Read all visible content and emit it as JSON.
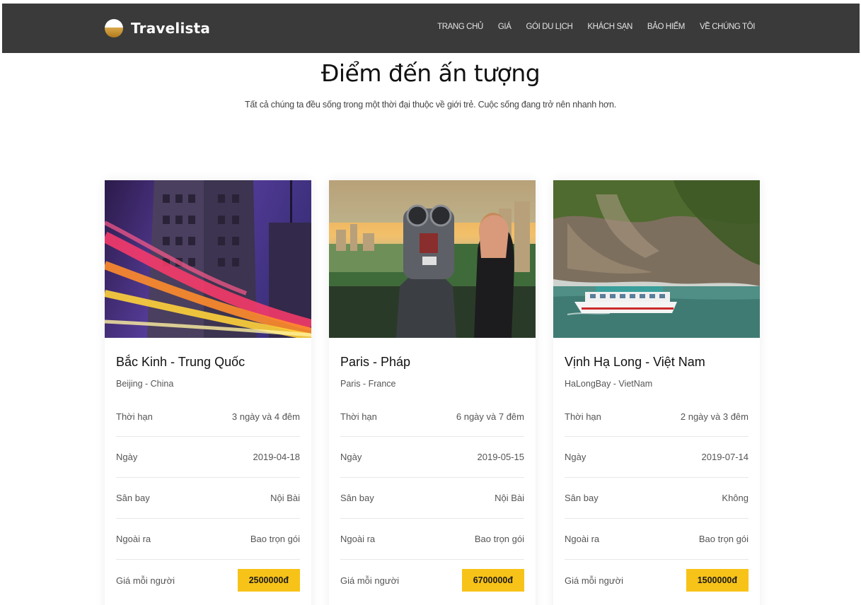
{
  "brand": {
    "name": "Travelista"
  },
  "nav": {
    "items": [
      "TRANG CHỦ",
      "GIÁ",
      "GÓI DU LỊCH",
      "KHÁCH SẠN",
      "BẢO HIỂM",
      "VỀ CHÚNG TÔI"
    ]
  },
  "hero": {
    "title": "Điểm đến ấn tượng",
    "subtitle": "Tất cả chúng ta đều sống trong một thời đại thuộc về giới trẻ. Cuộc sống đang trở nên nhanh hơn."
  },
  "cards": [
    {
      "title": "Bắc Kinh - Trung Quốc",
      "subtitle": "Beijing - China",
      "rows": [
        {
          "label": "Thời hạn",
          "value": "3 ngày và 4 đêm"
        },
        {
          "label": "Ngày",
          "value": "2019-04-18"
        },
        {
          "label": "Sân bay",
          "value": "Nội Bài"
        },
        {
          "label": "Ngoài ra",
          "value": "Bao trọn gói"
        }
      ],
      "price_label": "Giá mỗi người",
      "price": "2500000đ"
    },
    {
      "title": "Paris - Pháp",
      "subtitle": "Paris - France",
      "rows": [
        {
          "label": "Thời hạn",
          "value": "6 ngày và 7 đêm"
        },
        {
          "label": "Ngày",
          "value": "2019-05-15"
        },
        {
          "label": "Sân bay",
          "value": "Nội Bài"
        },
        {
          "label": "Ngoài ra",
          "value": "Bao trọn gói"
        }
      ],
      "price_label": "Giá mỗi người",
      "price": "6700000đ"
    },
    {
      "title": "Vịnh Hạ Long - Việt Nam",
      "subtitle": "HaLongBay - VietNam",
      "rows": [
        {
          "label": "Thời hạn",
          "value": "2 ngày và 3 đêm"
        },
        {
          "label": "Ngày",
          "value": "2019-07-14"
        },
        {
          "label": "Sân bay",
          "value": "Không"
        },
        {
          "label": "Ngoài ra",
          "value": "Bao trọn gói"
        }
      ],
      "price_label": "Giá mỗi người",
      "price": "1500000đ"
    }
  ],
  "colors": {
    "navbar_bg": "#3a3a3a",
    "price_badge": "#f8c318"
  }
}
